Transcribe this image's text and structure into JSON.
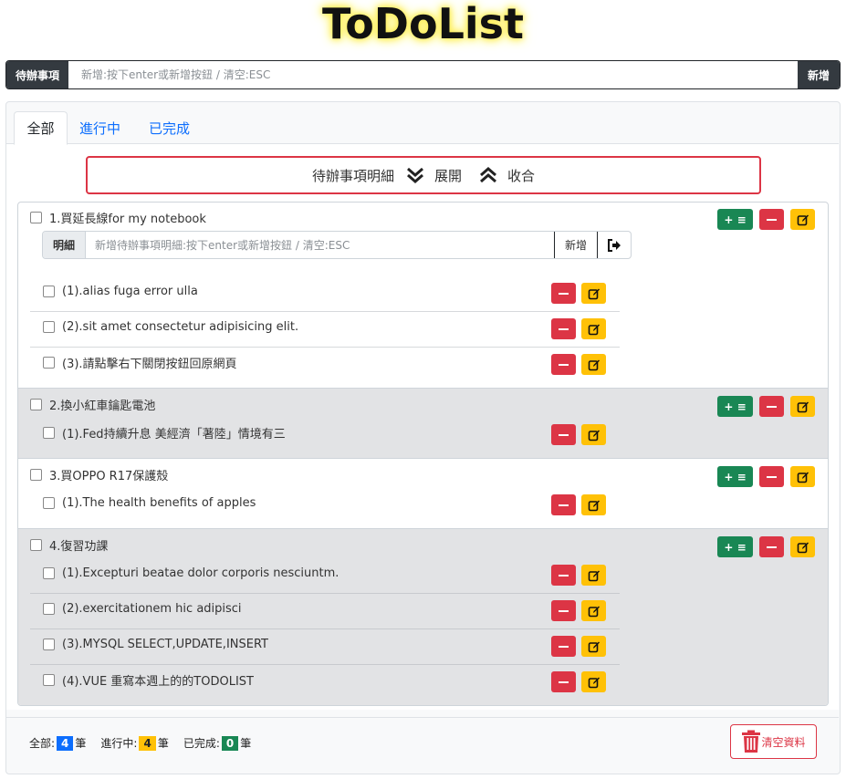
{
  "header": {
    "title": "ToDoList"
  },
  "main_input": {
    "label": "待辦事項",
    "placeholder": "新增:按下enter或新增按鈕 / 清空:ESC",
    "value": "",
    "add_label": "新增"
  },
  "tabs": [
    {
      "label": "全部"
    },
    {
      "label": "進行中"
    },
    {
      "label": "已完成"
    }
  ],
  "detail_bar": {
    "label": "待辦事項明細",
    "expand": "展開",
    "collapse": "收合"
  },
  "detail_input": {
    "label": "明細",
    "placeholder": "新增待辦事項明細:按下enter或新增按鈕 / 清空:ESC",
    "add_label": "新增"
  },
  "todos": [
    {
      "title": "1.買延長線for my notebook",
      "items": [
        "(1).alias fuga error ulla",
        "(2).sit amet consectetur adipisicing elit.",
        "(3).請點擊右下關閉按鈕回原網頁"
      ]
    },
    {
      "title": "2.換小紅車鑰匙電池",
      "items": [
        "(1).Fed持續升息 美經濟「著陸」情境有三"
      ]
    },
    {
      "title": "3.買OPPO R17保護殼",
      "items": [
        "(1).The health benefits of apples"
      ]
    },
    {
      "title": "4.復習功課",
      "items": [
        "(1).Excepturi beatae dolor corporis nesciuntm.",
        "(2).exercitationem hic adipisci",
        "(3).MYSQL SELECT,UPDATE,INSERT",
        "(4).VUE 重寫本週上的的TODOLIST"
      ]
    }
  ],
  "footer": {
    "all_label": "全部:",
    "all_count": "4",
    "active_label": "進行中:",
    "active_count": "4",
    "done_label": "已完成:",
    "done_count": "0",
    "unit": "筆",
    "clear_label": "清空資料"
  },
  "colors": {
    "danger": "#dc3545",
    "warning": "#ffc107",
    "success": "#198754",
    "primary": "#0d6efd",
    "dark": "#343a40"
  },
  "icons": {
    "add_detail": "plus-list-icon",
    "delete": "minus-icon",
    "edit": "edit-icon",
    "exit": "exit-icon",
    "trash": "trash-icon",
    "expand": "double-chevron-down-icon",
    "collapse": "double-chevron-up-icon"
  }
}
